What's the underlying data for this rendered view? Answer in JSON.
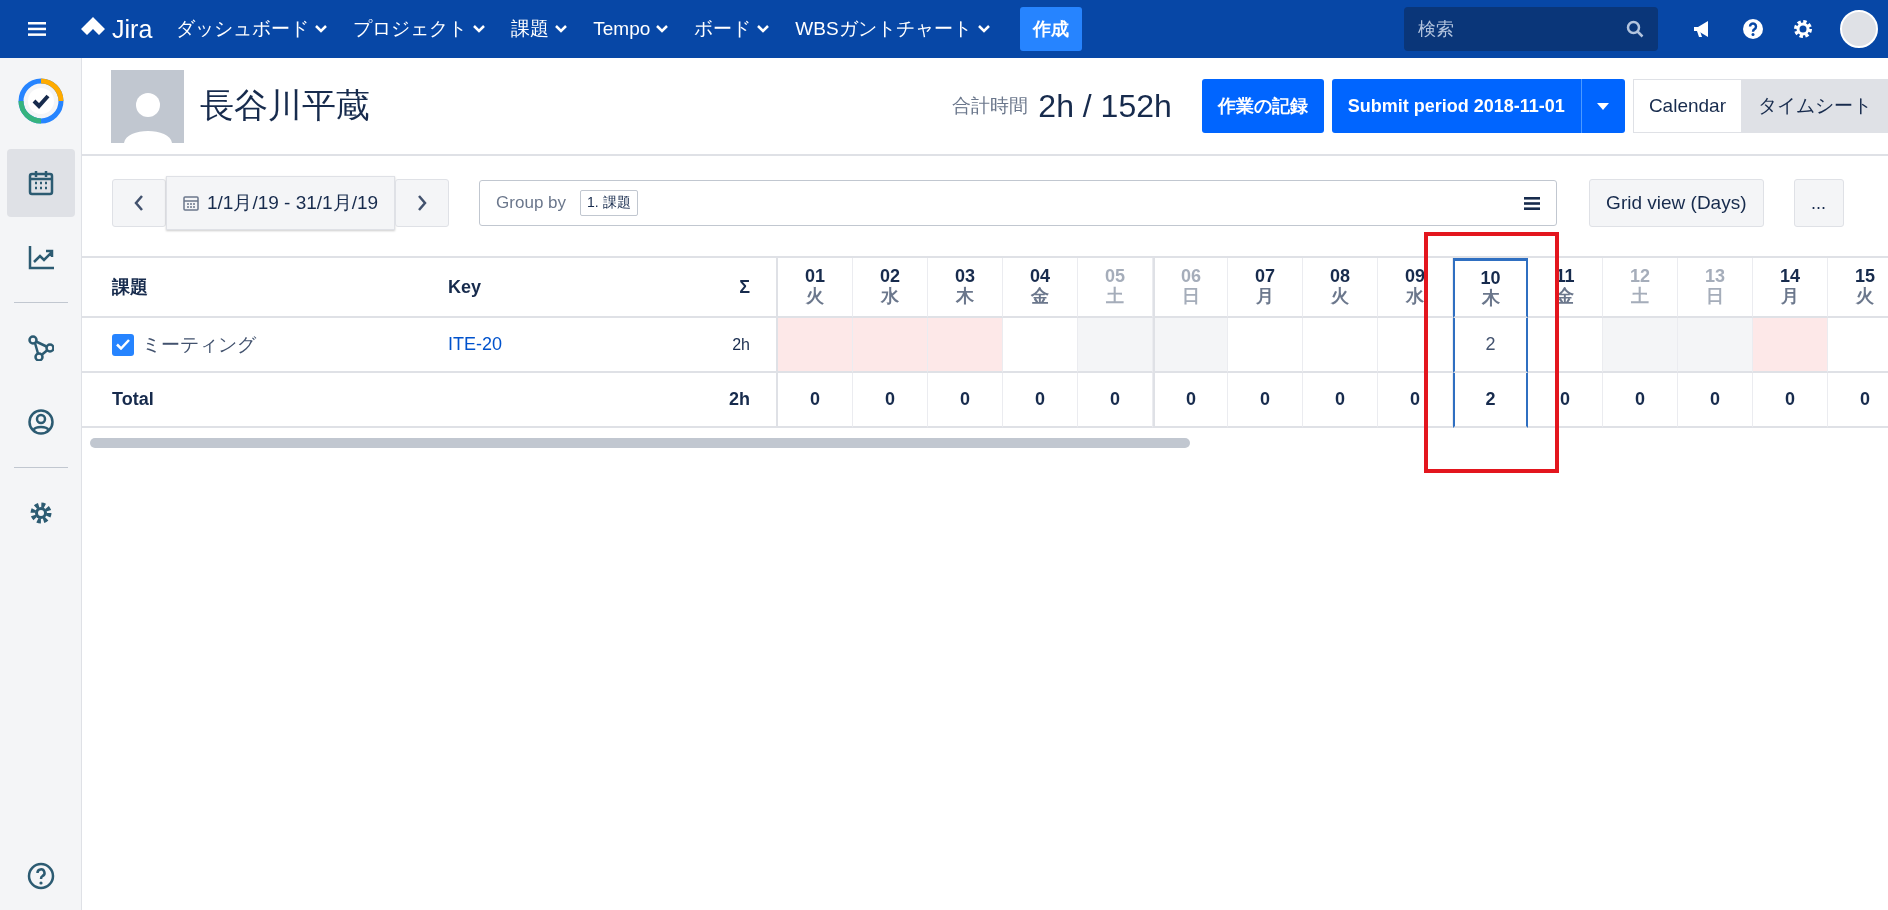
{
  "topbar": {
    "logo": "Jira",
    "menus": [
      {
        "label": "ダッシュボード"
      },
      {
        "label": "プロジェクト"
      },
      {
        "label": "課題"
      },
      {
        "label": "Tempo"
      },
      {
        "label": "ボード"
      },
      {
        "label": "WBSガントチャート"
      }
    ],
    "create_button": "作成",
    "search": {
      "placeholder": "検索"
    }
  },
  "sidebar": {
    "items": [
      {
        "kind": "calendar",
        "selected": true
      },
      {
        "kind": "chart",
        "selected": false
      },
      {
        "kind": "network",
        "selected": false
      },
      {
        "kind": "user",
        "selected": false
      },
      {
        "kind": "gear",
        "selected": false
      }
    ]
  },
  "header": {
    "user_name": "長谷川平蔵",
    "total_label": "合計時間",
    "total_value": "2h / 152h",
    "log_button": "作業の記録",
    "submit_button": "Submit period 2018-11-01",
    "views": [
      {
        "label": "Calendar",
        "selected": false
      },
      {
        "label": "タイムシート",
        "selected": true
      }
    ]
  },
  "toolbar": {
    "date_range": "1/1月/19 - 31/1月/19",
    "group_by_label": "Group by",
    "group_by_tag": "1. 課題",
    "view_button": "Grid view (Days)",
    "more_button": "..."
  },
  "table": {
    "columns": {
      "issue": "課題",
      "key": "Key",
      "sum": "Σ"
    },
    "rows": [
      {
        "checked": true,
        "issue": "ミーティング",
        "key": "ITE-20",
        "sum": "2h"
      }
    ],
    "total": {
      "label": "Total",
      "sum": "2h"
    },
    "days": [
      {
        "date": "01",
        "weekday": "火",
        "kind": "missing",
        "week_start": false,
        "selected": false,
        "total": "0"
      },
      {
        "date": "02",
        "weekday": "水",
        "kind": "missing",
        "week_start": false,
        "selected": false,
        "total": "0"
      },
      {
        "date": "03",
        "weekday": "木",
        "kind": "missing",
        "week_start": false,
        "selected": false,
        "total": "0"
      },
      {
        "date": "04",
        "weekday": "金",
        "kind": "normal",
        "week_start": false,
        "selected": false,
        "total": "0"
      },
      {
        "date": "05",
        "weekday": "土",
        "kind": "weekend",
        "week_start": false,
        "selected": false,
        "total": "0"
      },
      {
        "date": "06",
        "weekday": "日",
        "kind": "weekend",
        "week_start": true,
        "selected": false,
        "total": "0"
      },
      {
        "date": "07",
        "weekday": "月",
        "kind": "normal",
        "week_start": false,
        "selected": false,
        "total": "0"
      },
      {
        "date": "08",
        "weekday": "火",
        "kind": "normal",
        "week_start": false,
        "selected": false,
        "total": "0"
      },
      {
        "date": "09",
        "weekday": "水",
        "kind": "normal",
        "week_start": false,
        "selected": false,
        "total": "0"
      },
      {
        "date": "10",
        "weekday": "木",
        "kind": "normal",
        "week_start": false,
        "selected": true,
        "value": "2",
        "total": "2"
      },
      {
        "date": "11",
        "weekday": "金",
        "kind": "normal",
        "week_start": false,
        "selected": false,
        "total": "0"
      },
      {
        "date": "12",
        "weekday": "土",
        "kind": "weekend",
        "week_start": false,
        "selected": false,
        "total": "0"
      },
      {
        "date": "13",
        "weekday": "日",
        "kind": "weekend",
        "week_start": false,
        "selected": false,
        "total": "0"
      },
      {
        "date": "14",
        "weekday": "月",
        "kind": "missing",
        "week_start": false,
        "selected": false,
        "total": "0"
      },
      {
        "date": "15",
        "weekday": "火",
        "kind": "normal",
        "week_start": false,
        "selected": false,
        "total": "0"
      }
    ]
  }
}
